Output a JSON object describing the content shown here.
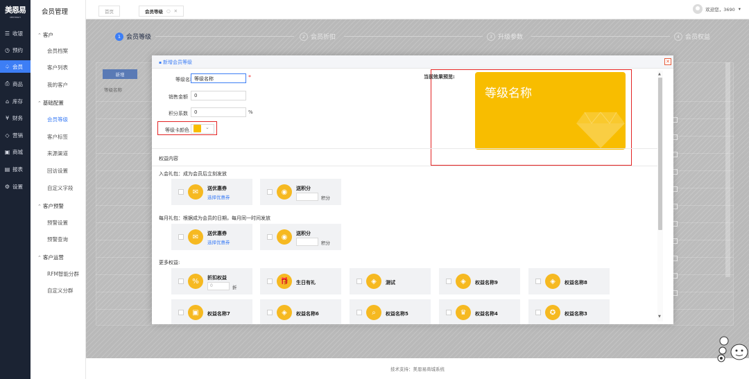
{
  "brand": {
    "logo_cn": "美恩易",
    "logo_en": "MEIYINGYI",
    "module_title": "会员管理"
  },
  "nav_main": [
    {
      "icon": "☰",
      "label": "收银"
    },
    {
      "icon": "◷",
      "label": "预约"
    },
    {
      "icon": "♤",
      "label": "会员"
    },
    {
      "icon": "⎙",
      "label": "商品"
    },
    {
      "icon": "⌂",
      "label": "库存"
    },
    {
      "icon": "¥",
      "label": "财务"
    },
    {
      "icon": "◇",
      "label": "营销"
    },
    {
      "icon": "▣",
      "label": "商城"
    },
    {
      "icon": "▤",
      "label": "报表"
    },
    {
      "icon": "⚙",
      "label": "设置"
    }
  ],
  "nav_sub": {
    "group_customer": "客户",
    "customer_items": [
      "会员档案",
      "客户列表",
      "我的客户"
    ],
    "group_config": "基础配置",
    "config_items": [
      "会员等级",
      "客户标签",
      "来源渠道",
      "回访设置",
      "自定义字段"
    ],
    "group_warn": "客户预警",
    "warn_items": [
      "预警设置",
      "预警查询"
    ],
    "group_ops": "客户运营",
    "ops_items": [
      "RFM智能分群",
      "自定义分群"
    ]
  },
  "tabs": [
    {
      "label": "首页"
    },
    {
      "label": "会员等级",
      "close": "✕"
    }
  ],
  "user": {
    "greeting": "欢迎您，3690",
    "caret": "▾"
  },
  "steps": [
    {
      "num": "1",
      "label": "会员等级"
    },
    {
      "num": "2",
      "label": "会员折扣"
    },
    {
      "num": "3",
      "label": "升级参数"
    },
    {
      "num": "4",
      "label": "会员权益"
    }
  ],
  "background": {
    "add_button": "新增",
    "column_label": "等级名称"
  },
  "modal": {
    "title": "新增会员等级",
    "close": "✕",
    "fields": {
      "name_label": "等级名称",
      "name_value": "等级名称",
      "required_mark": "*",
      "sales_label": "销售金额",
      "sales_value": "0",
      "points_label": "积分系数",
      "points_value": "0",
      "points_unit": "%",
      "color_label": "等级卡颜色",
      "color_value": "#f8bd00",
      "color_caret": "⌄"
    },
    "preview": {
      "label": "当前效果预览:",
      "card_name": "等级名称",
      "card_color": "#f8bd00"
    },
    "benefit_section": "权益内容",
    "join_gift": {
      "title": "入会礼包：成为会员后立刻发放",
      "coupon_name": "送优惠券",
      "coupon_link": "选择优惠券",
      "points_name": "送积分",
      "points_unit": "积分"
    },
    "monthly_gift": {
      "title": "每月礼包：根据成为会员的日期，每月同一时间发放",
      "coupon_name": "送优惠券",
      "coupon_link": "选择优惠券",
      "points_name": "送积分",
      "points_unit": "积分"
    },
    "more": {
      "title": "更多权益:",
      "discount_name": "折扣权益",
      "discount_placeholder": "0",
      "discount_unit": "折",
      "items": [
        "生日有礼",
        "测试",
        "权益名称9",
        "权益名称8",
        "权益名称7",
        "权益名称6",
        "权益名称5",
        "权益名称4",
        "权益名称3"
      ]
    }
  },
  "footer": "技术支持：美恩易商城系统"
}
